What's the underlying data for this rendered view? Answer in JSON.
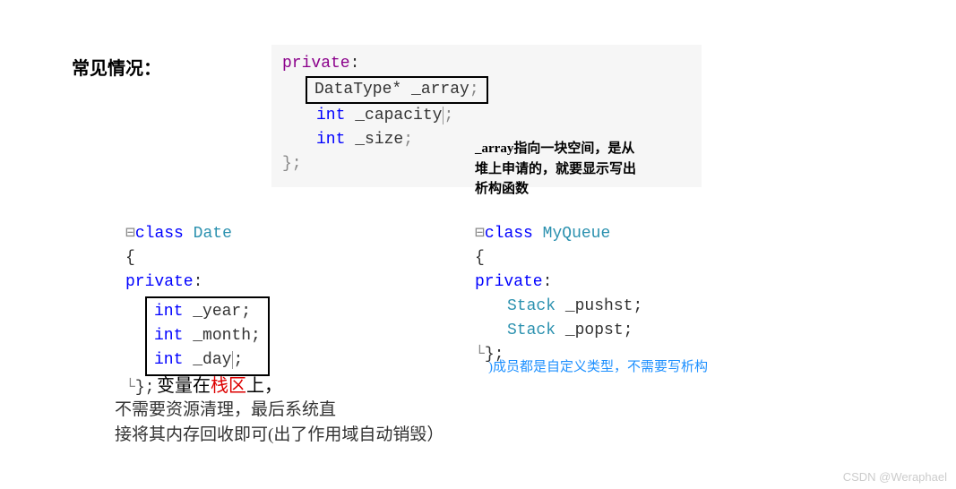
{
  "title": "常见情况：",
  "codeTop": {
    "l1_kw": "private",
    "l1_colon": ":",
    "box_type": "DataType*",
    "box_name": "_array",
    "semi": ";",
    "l3_type": "int",
    "l3_name": "_capacity",
    "l4_type": "int",
    "l4_name": "_size",
    "close": "};"
  },
  "annotTop": {
    "l1": "_array指向一块空间，是从",
    "l2": "堆上申请的，就要显示写出",
    "l3": "析构函数"
  },
  "codeLeft": {
    "class_kw": "class",
    "class_name": "Date",
    "open": "{",
    "priv_kw": "private",
    "priv_colon": ":",
    "t_int": "int",
    "m1": "_year",
    "m2": "_month",
    "m3": "_day",
    "semi": ";",
    "close": "};"
  },
  "annotLeft": {
    "p1a": "变量在",
    "p1b": "栈区",
    "p1c": "上，",
    "p2": "不需要资源清理，最后系统直",
    "p3": "接将其内存回收即可(出了作用域自动销毁）"
  },
  "codeRight": {
    "class_kw": "class",
    "class_name": "MyQueue",
    "open": "{",
    "priv_kw": "private",
    "priv_colon": ":",
    "ty": "Stack",
    "m1": "_pushst",
    "m2": "_popst",
    "semi": ";",
    "close": "};"
  },
  "annotRight": ")成员都是自定义类型，不需要写析构",
  "watermark": "CSDN @Weraphael"
}
